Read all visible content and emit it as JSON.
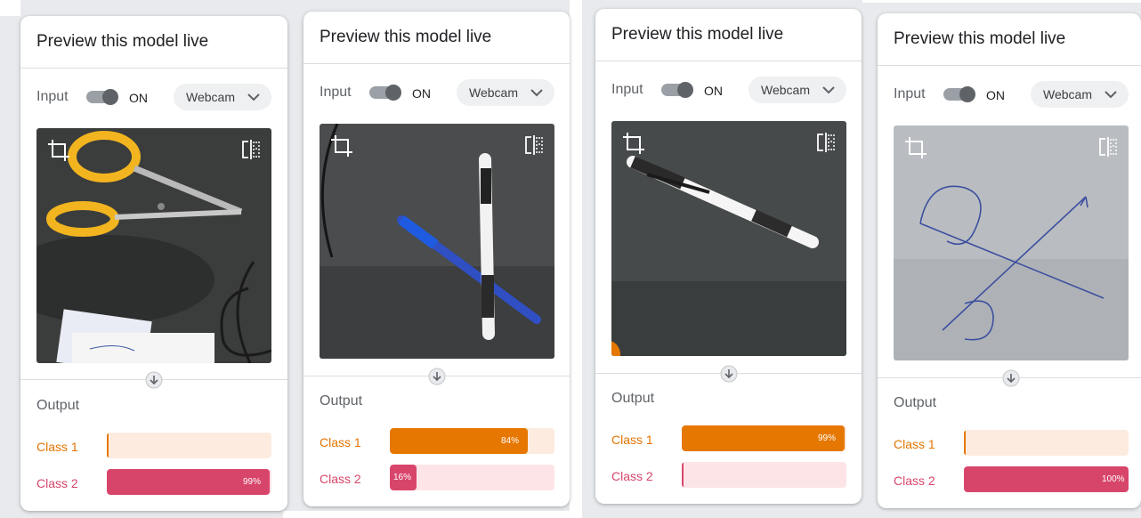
{
  "panels": [
    {
      "title": "Preview this model live",
      "input": {
        "label": "Input",
        "toggle_state": "ON",
        "source": "Webcam"
      },
      "output_label": "Output",
      "classes": [
        {
          "name": "Class 1",
          "confidence": 0.01,
          "pct_label": ""
        },
        {
          "name": "Class 2",
          "confidence": 0.99,
          "pct_label": "99%"
        }
      ]
    },
    {
      "title": "Preview this model live",
      "input": {
        "label": "Input",
        "toggle_state": "ON",
        "source": "Webcam"
      },
      "output_label": "Output",
      "classes": [
        {
          "name": "Class 1",
          "confidence": 0.84,
          "pct_label": "84%"
        },
        {
          "name": "Class 2",
          "confidence": 0.16,
          "pct_label": "16%"
        }
      ]
    },
    {
      "title": "Preview this model live",
      "input": {
        "label": "Input",
        "toggle_state": "ON",
        "source": "Webcam"
      },
      "output_label": "Output",
      "classes": [
        {
          "name": "Class 1",
          "confidence": 0.99,
          "pct_label": "99%"
        },
        {
          "name": "Class 2",
          "confidence": 0.01,
          "pct_label": ""
        }
      ]
    },
    {
      "title": "Preview this model live",
      "input": {
        "label": "Input",
        "toggle_state": "ON",
        "source": "Webcam"
      },
      "output_label": "Output",
      "classes": [
        {
          "name": "Class 1",
          "confidence": 0.0,
          "pct_label": ""
        },
        {
          "name": "Class 2",
          "confidence": 1.0,
          "pct_label": "100%"
        }
      ]
    }
  ],
  "colors": {
    "class_1": "#e67700",
    "class_1_track": "#fdebe0",
    "class_2": "#d8456b",
    "class_2_track": "#fde4e7"
  },
  "icons": [
    "crop-icon",
    "flip-horizontal-icon",
    "chevron-down-icon",
    "arrow-down-circle-icon",
    "toggle-switch"
  ]
}
